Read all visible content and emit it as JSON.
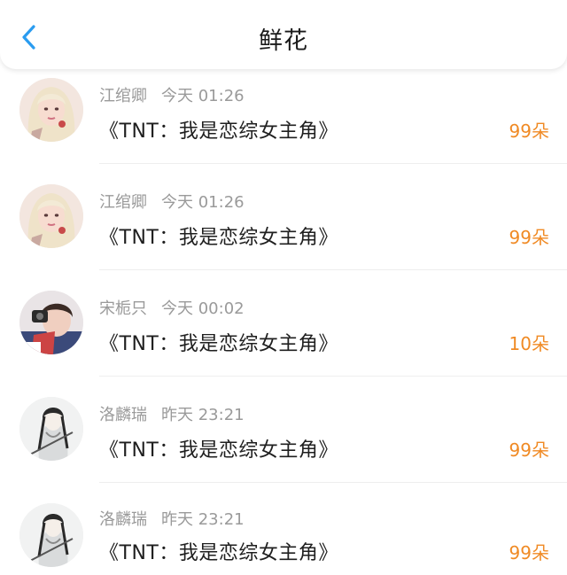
{
  "header": {
    "title": "鲜花",
    "back_icon": "chevron-left-icon",
    "accent": "#2a9cf0"
  },
  "colors": {
    "count": "#f08a24",
    "meta": "#9a9a9a"
  },
  "items": [
    {
      "name": "江绾卿",
      "time": "今天 01:26",
      "book": "《TNT：我是恋综女主角》",
      "count": "99朵",
      "avatar": "blonde-girl-avatar"
    },
    {
      "name": "江绾卿",
      "time": "今天 01:26",
      "book": "《TNT：我是恋综女主角》",
      "count": "99朵",
      "avatar": "blonde-girl-avatar"
    },
    {
      "name": "宋栀只",
      "time": "今天 00:02",
      "book": "《TNT：我是恋综女主角》",
      "count": "10朵",
      "avatar": "photo-girl-avatar"
    },
    {
      "name": "洛麟瑞",
      "time": "昨天 23:21",
      "book": "《TNT：我是恋综女主角》",
      "count": "99朵",
      "avatar": "ink-swordsman-avatar"
    },
    {
      "name": "洛麟瑞",
      "time": "昨天 23:21",
      "book": "《TNT：我是恋综女主角》",
      "count": "99朵",
      "avatar": "ink-swordsman-avatar"
    }
  ]
}
